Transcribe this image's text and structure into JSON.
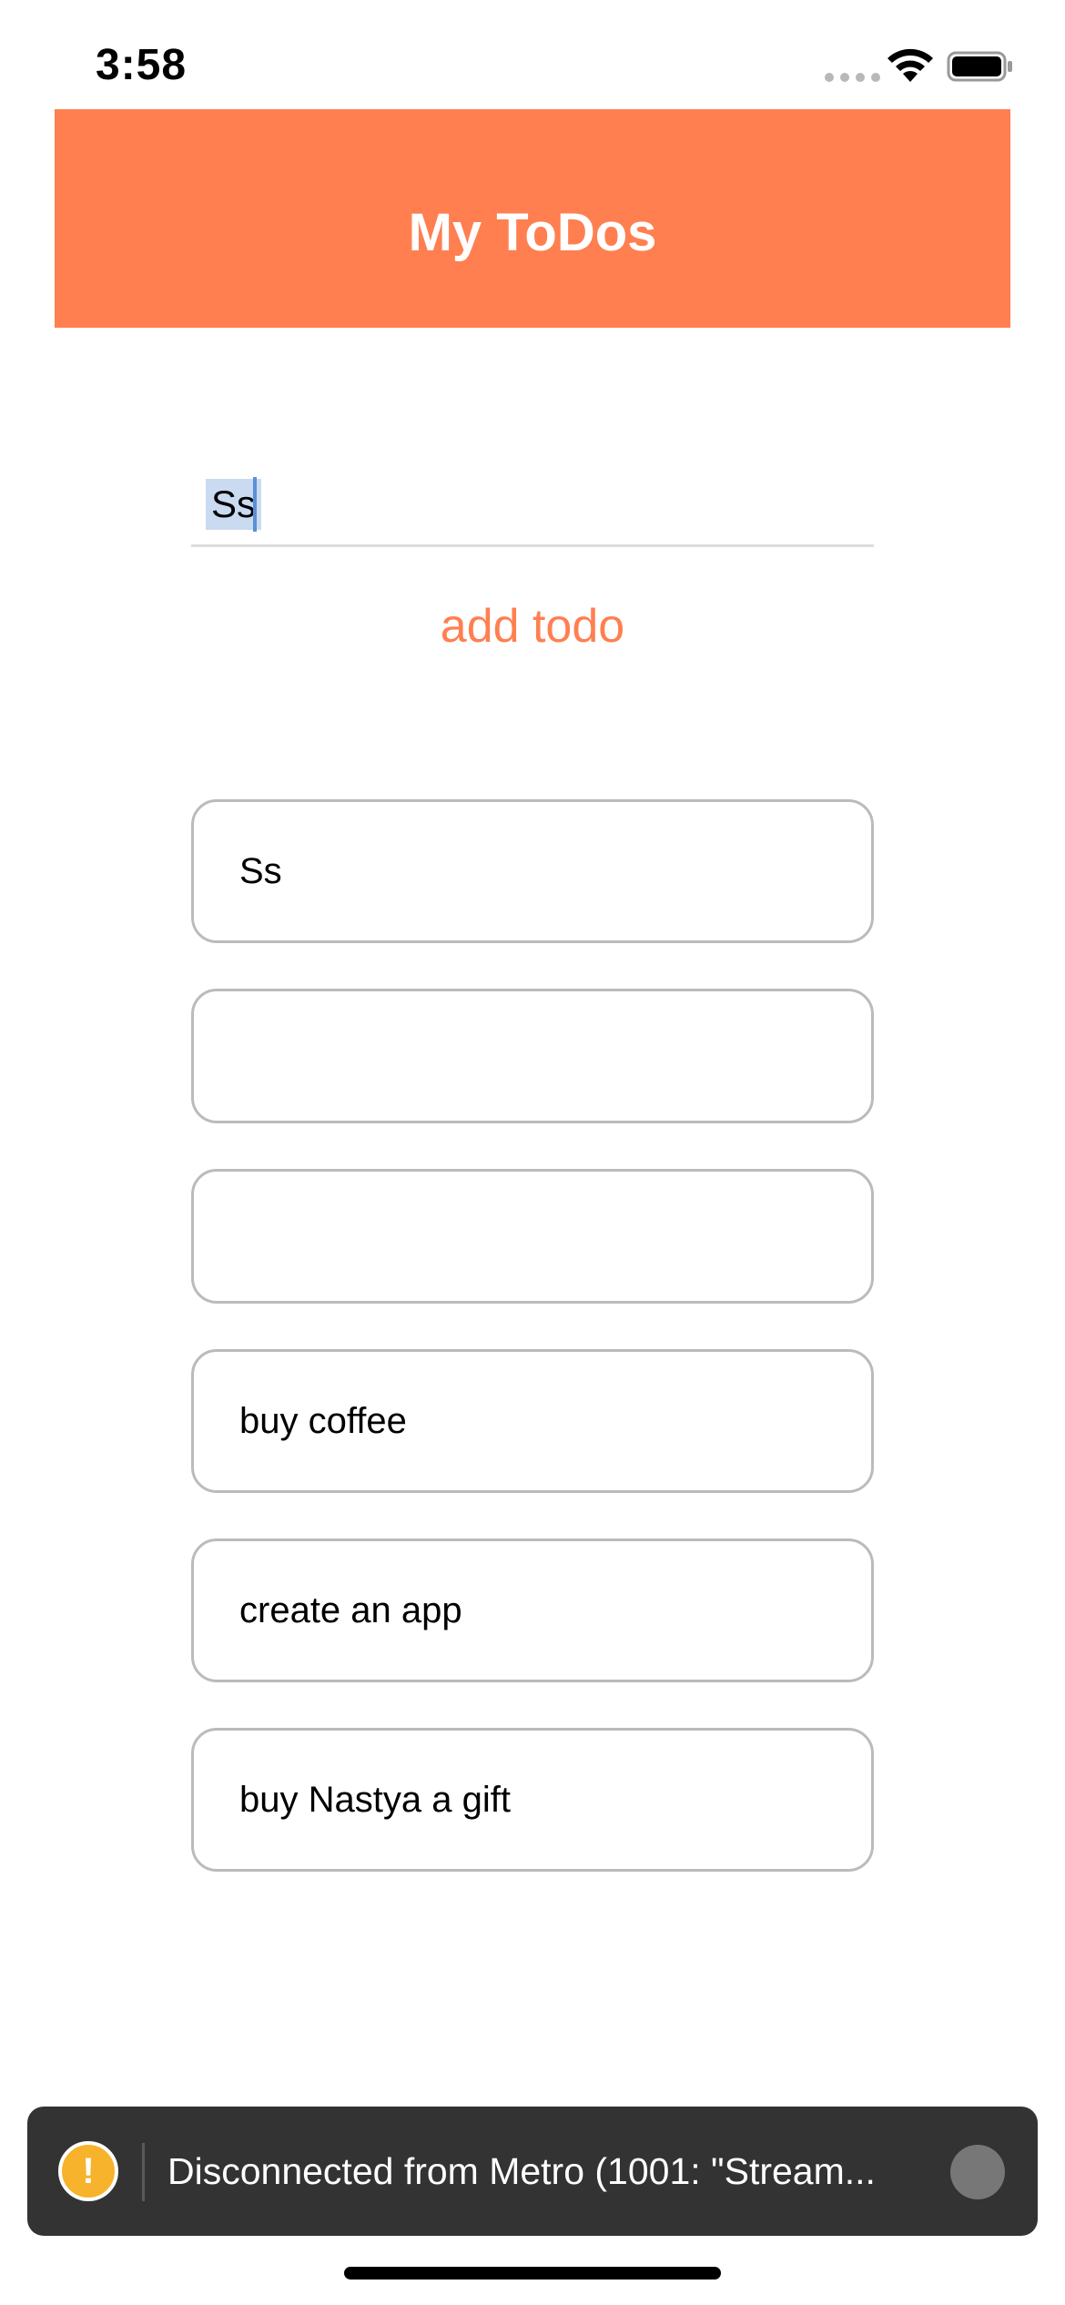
{
  "status_bar": {
    "time": "3:58",
    "icons": [
      "signal-dots-icon",
      "wifi-icon",
      "battery-icon"
    ]
  },
  "header": {
    "title": "My ToDos",
    "color": "#ff7f50"
  },
  "input": {
    "value": "Ss"
  },
  "add_button": {
    "label": "add todo",
    "color": "#ff7f50"
  },
  "todos": [
    {
      "text": "Ss"
    },
    {
      "text": ""
    },
    {
      "text": ""
    },
    {
      "text": "buy coffee"
    },
    {
      "text": "create an app"
    },
    {
      "text": "buy Nastya a gift"
    }
  ],
  "toast": {
    "icon": "warning-icon",
    "message": "Disconnected from Metro (1001: \"Stream..."
  }
}
